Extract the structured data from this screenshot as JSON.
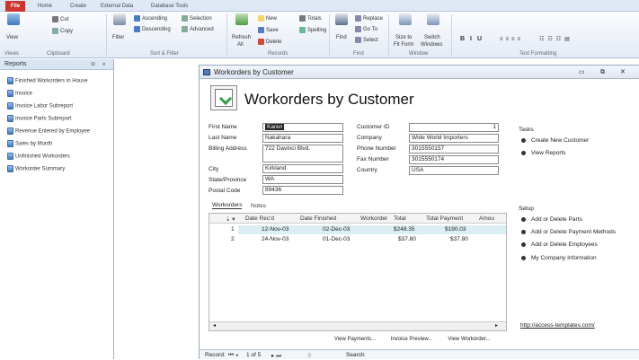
{
  "ribbon_tabs": [
    "File",
    "Home",
    "Create",
    "External Data",
    "Database Tools"
  ],
  "ribbon": {
    "view": "View",
    "cut": "Cut",
    "copy": "Copy",
    "filter": "Filter",
    "ascending": "Ascending",
    "descending": "Descending",
    "selection": "Selection",
    "advanced": "Advanced",
    "refresh": "Refresh",
    "refresh2": "All",
    "new": "New",
    "save": "Save",
    "delete": "Delete",
    "totals": "Totals",
    "spelling": "Spelling",
    "find": "Find",
    "replace": "Replace",
    "goto": "Go To",
    "select": "Select",
    "sizefit": "Size to",
    "sizefit2": "Fit Form",
    "switch": "Switch",
    "switch2": "Windows",
    "groups": [
      "Views",
      "Clipboard",
      "Sort & Filter",
      "Records",
      "Find",
      "Window",
      "Text Formatting"
    ]
  },
  "nav": {
    "title": "Reports",
    "items": [
      "Finished Workorders in House",
      "Invoice",
      "Invoice Labor Subreport",
      "Invoice Parts Subreport",
      "Revenue Entered by Employee",
      "Sales by Month",
      "Unfinished Workorders",
      "Workorder Summary"
    ]
  },
  "form": {
    "window_title": "Workorders by Customer",
    "heading": "Workorders by Customer",
    "labels": {
      "first_name": "First Name",
      "last_name": "Last Name",
      "billing_address": "Billing Address",
      "city": "City",
      "state": "State/Province",
      "postal": "Postal Code",
      "customer_id": "Customer ID",
      "company": "Company",
      "phone": "Phone Number",
      "fax": "Fax Number",
      "country": "Country"
    },
    "values": {
      "first_name": "Karen",
      "last_name": "Nakahara",
      "billing_address": "722 Davinci Blvd.",
      "city": "Kirkland",
      "state": "WA",
      "postal": "89436",
      "customer_id": "1",
      "company": "Wide World Importers",
      "phone": "3015550157",
      "fax": "3015550174",
      "country": "USA"
    },
    "subtabs": [
      "Workorders",
      "Notes"
    ],
    "grid_headers": [
      "",
      "Date Rec'd",
      "Date Finished",
      "Workorder",
      "Total",
      "Total Payment",
      "Amou"
    ],
    "rows": [
      {
        "num": "1",
        "rec": "12-Nov-03",
        "fin": "02-Dec-03",
        "total": "$248.35",
        "pay": "$190.03"
      },
      {
        "num": "2",
        "rec": "24-Nov-03",
        "fin": "01-Dec-03",
        "total": "$37.80",
        "pay": "$37.80"
      }
    ],
    "buttons": [
      "View Payments...",
      "Invoice Preview...",
      "View Workorder..."
    ],
    "record_nav": {
      "label": "Record:",
      "pos": "1 of 5",
      "search": "Search"
    }
  },
  "tasks": {
    "title": "Tasks",
    "items": [
      "Create New Customer",
      "View Reports"
    ]
  },
  "setup": {
    "title": "Setup",
    "items": [
      "Add or Delete Parts",
      "Add or Delete Payment Methods",
      "Add or Delete Employees",
      "My Company Information"
    ]
  },
  "link": "http://access-templates.com/"
}
